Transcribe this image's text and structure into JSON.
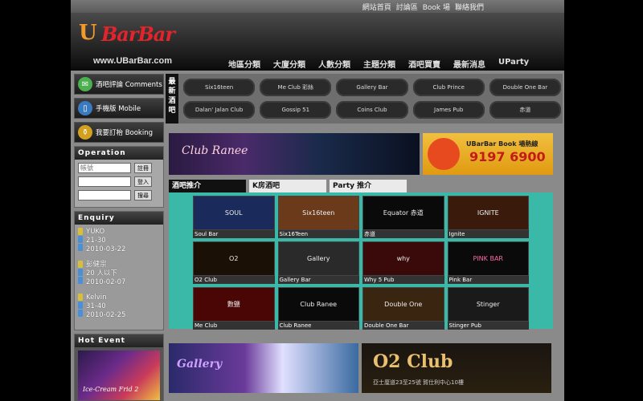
{
  "top_links": [
    "網站首頁",
    "討論區",
    "Book 場",
    "聯絡我們"
  ],
  "logo": {
    "text": "BarBar",
    "u": "U",
    "url": "www.UBarBar.com"
  },
  "main_nav": [
    "地區分類",
    "大廈分類",
    "人數分類",
    "主題分類",
    "酒吧買賣",
    "最新消息",
    "UParty"
  ],
  "left_buttons": [
    {
      "label": "酒吧評論  Comments",
      "icon": "chat-bubble-icon"
    },
    {
      "label": "手機版  Mobile",
      "icon": "mobile-phone-icon"
    },
    {
      "label": "我要訂枱  Booking",
      "icon": "bottle-icon"
    }
  ],
  "operation": {
    "title": "Operation",
    "username_label": "帳號",
    "buttons": [
      "註冊",
      "登入",
      "搜尋"
    ]
  },
  "enquiry": {
    "title": "Enquiry",
    "entries": [
      {
        "name": "YUKO",
        "age": "21-30",
        "date": "2010-03-22"
      },
      {
        "name": "彭健宗",
        "age": "20 人以下",
        "date": "2010-02-07"
      },
      {
        "name": "Kelvin",
        "age": "31-40",
        "date": "2010-02-25"
      }
    ]
  },
  "hot_event": {
    "title": "Hot Event",
    "caption": "Ice-Cream Frid  2"
  },
  "new_bars": {
    "label": "最新酒吧",
    "items": [
      "Six16teen",
      "Me Club 彩絲",
      "Gallery Bar",
      "Club Prince",
      "Double One Bar",
      "Dalan' Jalan Club",
      "Gossip 51",
      "Coins Club",
      "James Pub",
      "赤道"
    ]
  },
  "banner": {
    "club_name": "Club Ranee",
    "book_line": "UBarBar Book 場熱線",
    "phone": "9197 6900"
  },
  "tabs": [
    "酒吧推介",
    "K房酒吧",
    "Party   推介"
  ],
  "grid": [
    {
      "title": "SOUL",
      "caption": "Soul Bar"
    },
    {
      "title": "Six16teen",
      "caption": "Six16Teen"
    },
    {
      "title": "Equator 赤道",
      "caption": "赤道"
    },
    {
      "title": "IGNITE",
      "caption": "Ignite"
    },
    {
      "title": "O2",
      "caption": "O2 Club"
    },
    {
      "title": "Gallery",
      "caption": "Gallery Bar"
    },
    {
      "title": "why",
      "caption": "Why 5 Pub"
    },
    {
      "title": "PINK BAR",
      "caption": "Pink Bar"
    },
    {
      "title": "數鹽",
      "caption": "Me Club"
    },
    {
      "title": "Club Ranee",
      "caption": "Club Ranee"
    },
    {
      "title": "Double One",
      "caption": "Double One Bar"
    },
    {
      "title": "Stinger",
      "caption": "Stinger Pub"
    }
  ],
  "bottom_banners": {
    "gallery": "Gallery",
    "o2": "O2 Club",
    "o2_addr": "亞士厘道23至25號 賀仕利中心10樓"
  }
}
